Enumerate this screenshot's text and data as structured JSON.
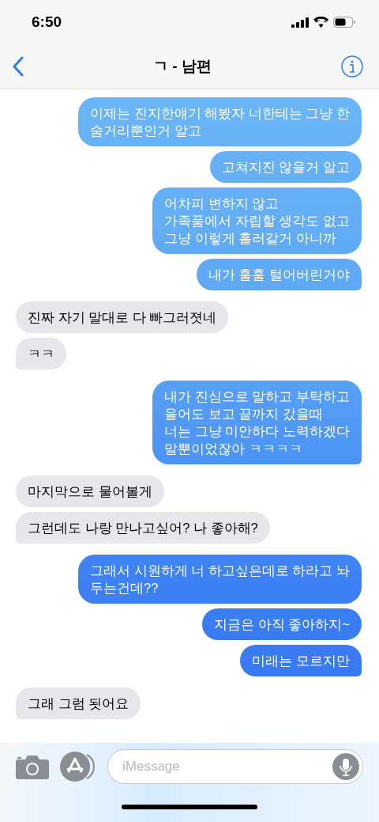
{
  "status_bar": {
    "time": "6:50"
  },
  "nav": {
    "title": "ㄱ - 남편"
  },
  "messages": [
    {
      "kind": "sent",
      "text": "이제는 진지한얘기 해봤자 너한테는 그냥 한\n숨거리뿐인거 알고",
      "tail": false
    },
    {
      "kind": "sent",
      "text": "고쳐지진 않을거 알고",
      "tail": false
    },
    {
      "kind": "sent",
      "text": "어차피 변하지 않고\n가족품에서 자립할 생각도 없고\n그냥 이렇게 흘러갈거 아니까",
      "tail": false
    },
    {
      "kind": "sent",
      "text": "내가 훌훌 털어버린거야",
      "tail": true
    },
    {
      "kind": "received",
      "text": "진짜 자기 말대로 다 빠그러졋네",
      "tail": false
    },
    {
      "kind": "received",
      "text": "ㅋㅋ",
      "tail": true
    },
    {
      "kind": "sent",
      "text": "내가 진심으로 말하고 부탁하고\n울어도 보고 끝까지 갔을때\n너는 그냥 미안하다 노력하겠다\n말뿐이었잖아 ㅋㅋㅋㅋ",
      "tail": true
    },
    {
      "kind": "received",
      "text": "마지막으로 물어볼게",
      "tail": false
    },
    {
      "kind": "received",
      "text": "그런데도 나랑 만나고싶어? 나 좋아해?",
      "tail": true
    },
    {
      "kind": "sent",
      "text": "그래서  시원하게 너 하고싶은데로 하라고 놔\n두는건데??",
      "tail": false
    },
    {
      "kind": "sent",
      "text": "지금은 아직 좋아하지~",
      "tail": false
    },
    {
      "kind": "sent",
      "text": "미래는 모르지만",
      "tail": true
    },
    {
      "kind": "received",
      "text": "그래 그럼 됫어요",
      "tail": true
    }
  ],
  "compose": {
    "placeholder": "iMessage"
  }
}
